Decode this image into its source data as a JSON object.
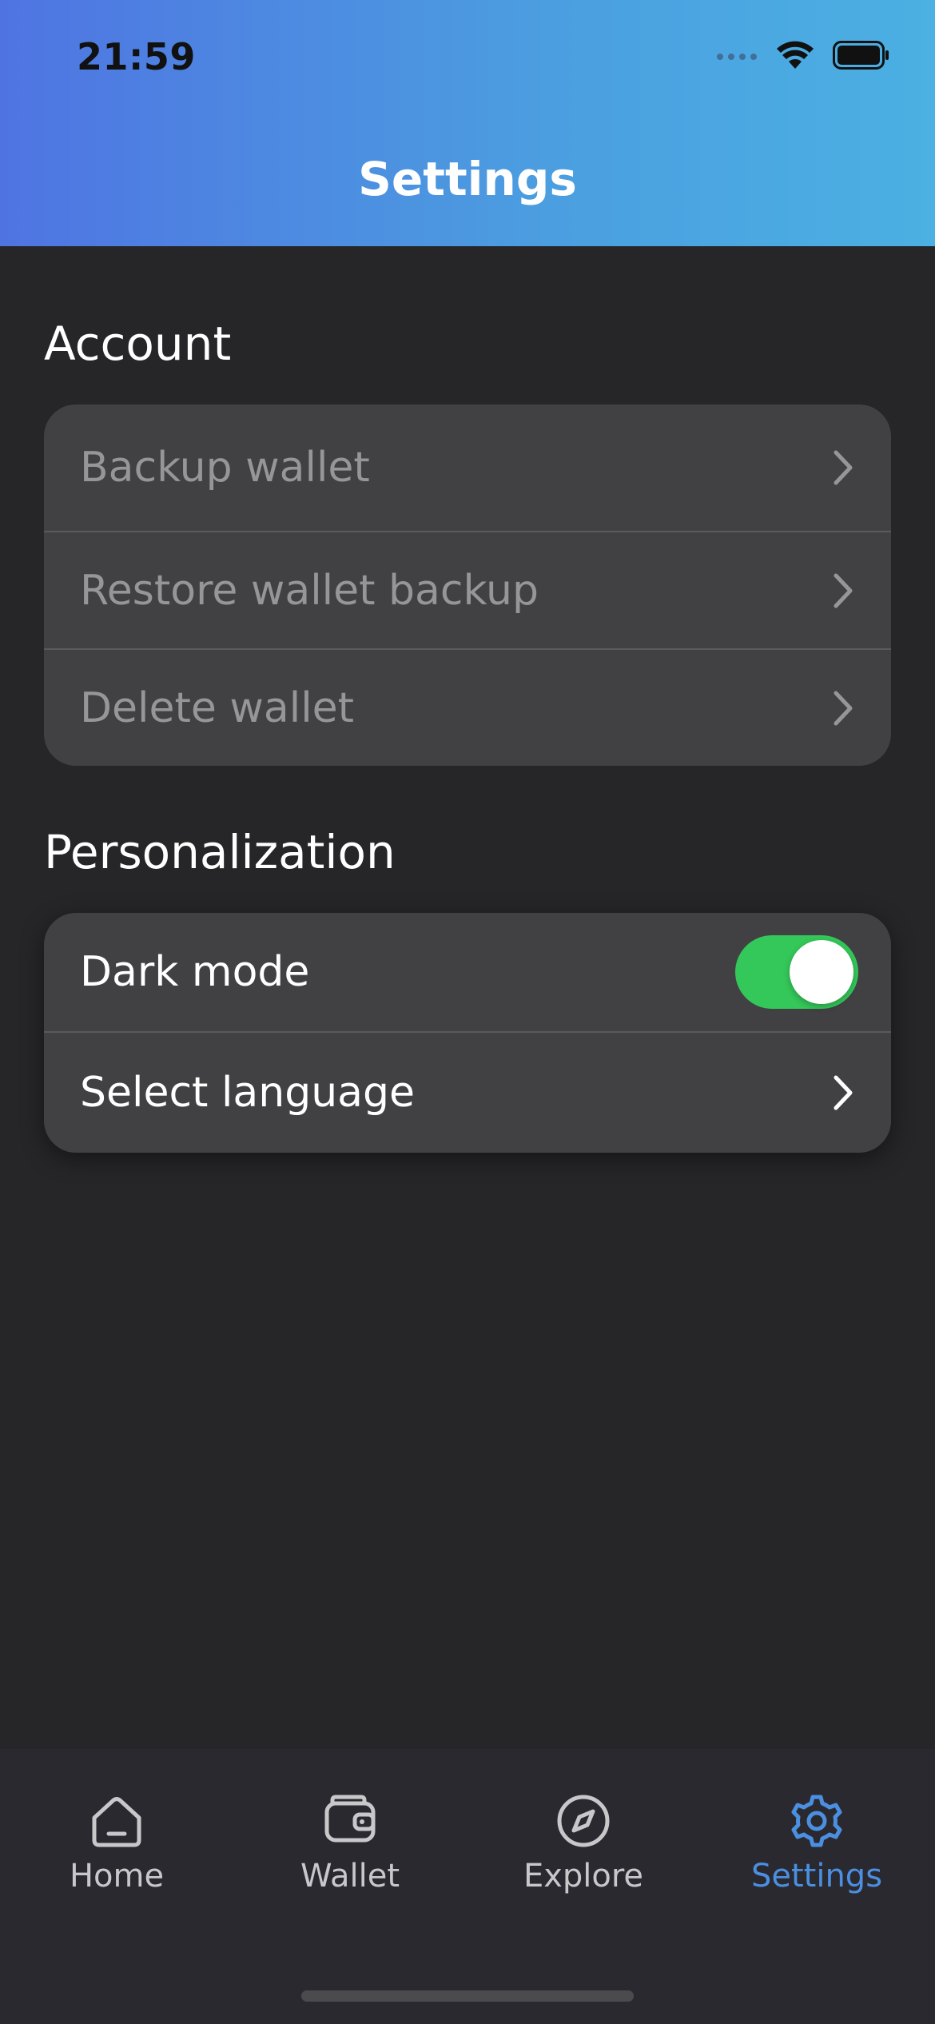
{
  "status_bar": {
    "time": "21:59",
    "icons": [
      "signal-dots-icon",
      "wifi-icon",
      "battery-icon"
    ]
  },
  "header": {
    "title": "Settings"
  },
  "sections": {
    "account": {
      "title": "Account",
      "items": [
        {
          "label": "Backup wallet",
          "icon": "chevron-right-icon",
          "enabled": false
        },
        {
          "label": "Restore wallet backup",
          "icon": "chevron-right-icon",
          "enabled": false
        },
        {
          "label": "Delete wallet",
          "icon": "chevron-right-icon",
          "enabled": false
        }
      ]
    },
    "personalization": {
      "title": "Personalization",
      "dark_mode": {
        "label": "Dark mode",
        "on": true
      },
      "language": {
        "label": "Select language",
        "icon": "chevron-right-icon"
      }
    }
  },
  "tabbar": {
    "tabs": [
      {
        "label": "Home",
        "icon": "home-icon",
        "active": false
      },
      {
        "label": "Wallet",
        "icon": "wallet-icon",
        "active": false
      },
      {
        "label": "Explore",
        "icon": "compass-icon",
        "active": false
      },
      {
        "label": "Settings",
        "icon": "gear-icon",
        "active": true
      }
    ]
  },
  "colors": {
    "header_gradient_start": "#4f74e2",
    "header_gradient_end": "#4bb0e2",
    "background": "#262628",
    "card": "#414143",
    "toggle_on": "#34c759",
    "active_tab": "#4a8fe0"
  }
}
